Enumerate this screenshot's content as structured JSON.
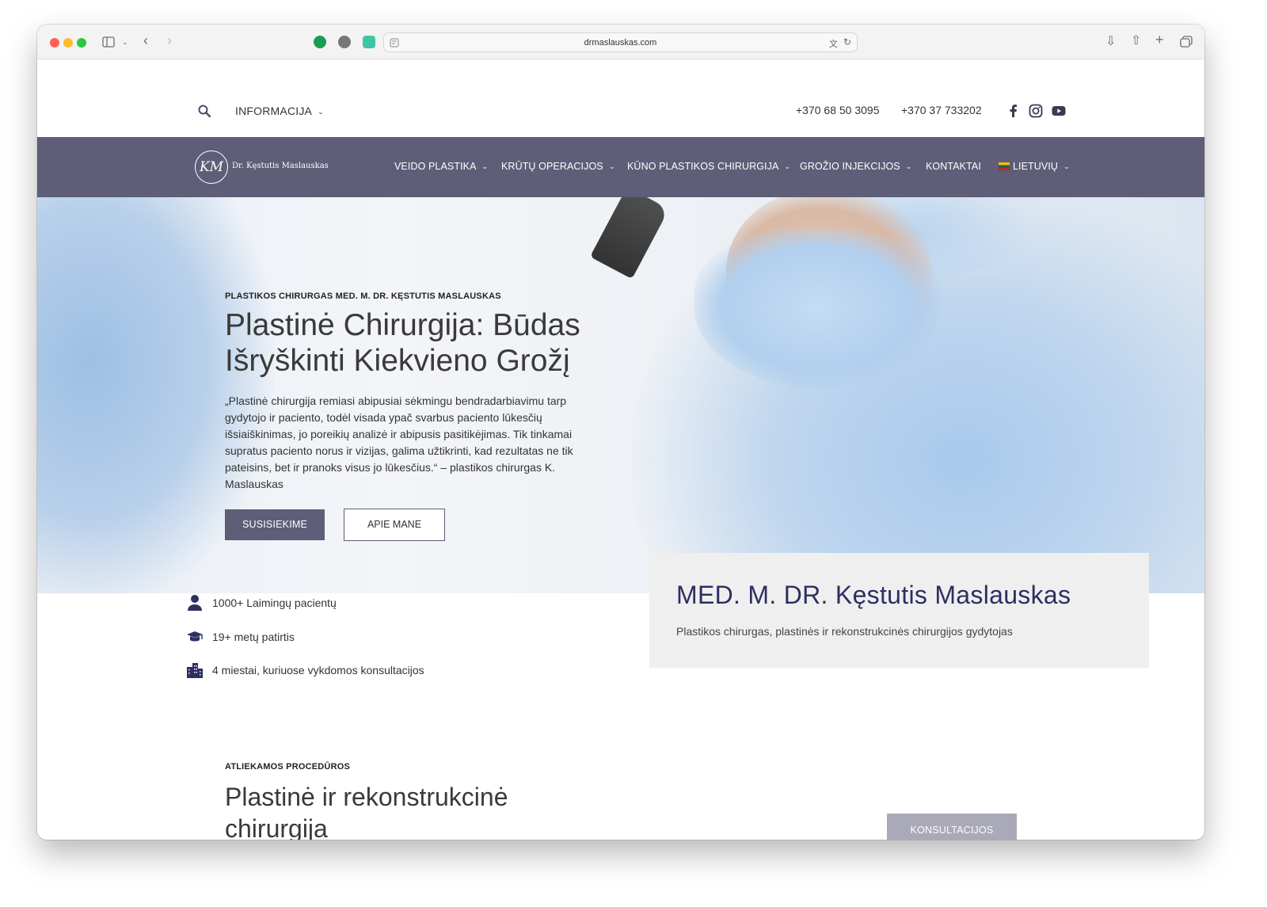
{
  "browser": {
    "url": "drmaslauskas.com"
  },
  "topbar": {
    "info_label": "INFORMACIJA",
    "phone1": "+370 68 50 3095",
    "phone2": "+370 37 733202",
    "social": [
      "facebook-icon",
      "instagram-icon",
      "youtube-icon"
    ]
  },
  "nav": {
    "logo_monogram": "KM",
    "logo_text": "Dr. Kęstutis Maslauskas",
    "items": [
      {
        "label": "VEIDO PLASTIKA"
      },
      {
        "label": "KRŪTŲ OPERACIJOS"
      },
      {
        "label": "KŪNO PLASTIKOS CHIRURGIJA"
      },
      {
        "label": "GROŽIO INJEKCIJOS"
      },
      {
        "label": "KONTAKTAI"
      },
      {
        "label": "LIETUVIŲ"
      }
    ]
  },
  "hero": {
    "subtitle": "PLASTIKOS CHIRURGAS MED. M. DR. KĘSTUTIS MASLAUSKAS",
    "title": "Plastinė Chirurgija: Būdas Išryškinti Kiekvieno Grožį",
    "quote": "„Plastinė chirurgija remiasi abipusiai sėkmingu bendradarbiavimu tarp gydytojo ir paciento, todėl visada ypač svarbus paciento lūkesčių išsiaiškinimas, jo poreikių analizė ir abipusis pasitikėjimas. Tik tinkamai supratus paciento norus ir vizijas, galima užtikrinti, kad rezultatas ne tik pateisins, bet ir pranoks visus jo lūkesčius.“ – plastikos chirurgas K. Maslauskas",
    "btn_primary": "SUSISIEKIME",
    "btn_secondary": "APIE MANE"
  },
  "stats": [
    {
      "icon": "person-icon",
      "text": "1000+ Laimingų pacientų"
    },
    {
      "icon": "graduation-cap-icon",
      "text": "19+ metų patirtis"
    },
    {
      "icon": "city-icon",
      "text": "4 miestai, kuriuose vykdomos konsultacijos"
    }
  ],
  "card": {
    "title": "MED. M. DR. Kęstutis Maslauskas",
    "subtitle": "Plastikos chirurgas, plastinės ir rekonstrukcinės chirurgijos gydytojas"
  },
  "procedures": {
    "label": "ATLIEKAMOS PROCEDŪROS",
    "title": "Plastinė ir rekonstrukcinė chirurgija",
    "btn": "KONSULTACIJOS"
  },
  "colors": {
    "nav_bg": "#5e5e78",
    "card_title": "#2e2e62",
    "card_bg": "#efefef"
  }
}
